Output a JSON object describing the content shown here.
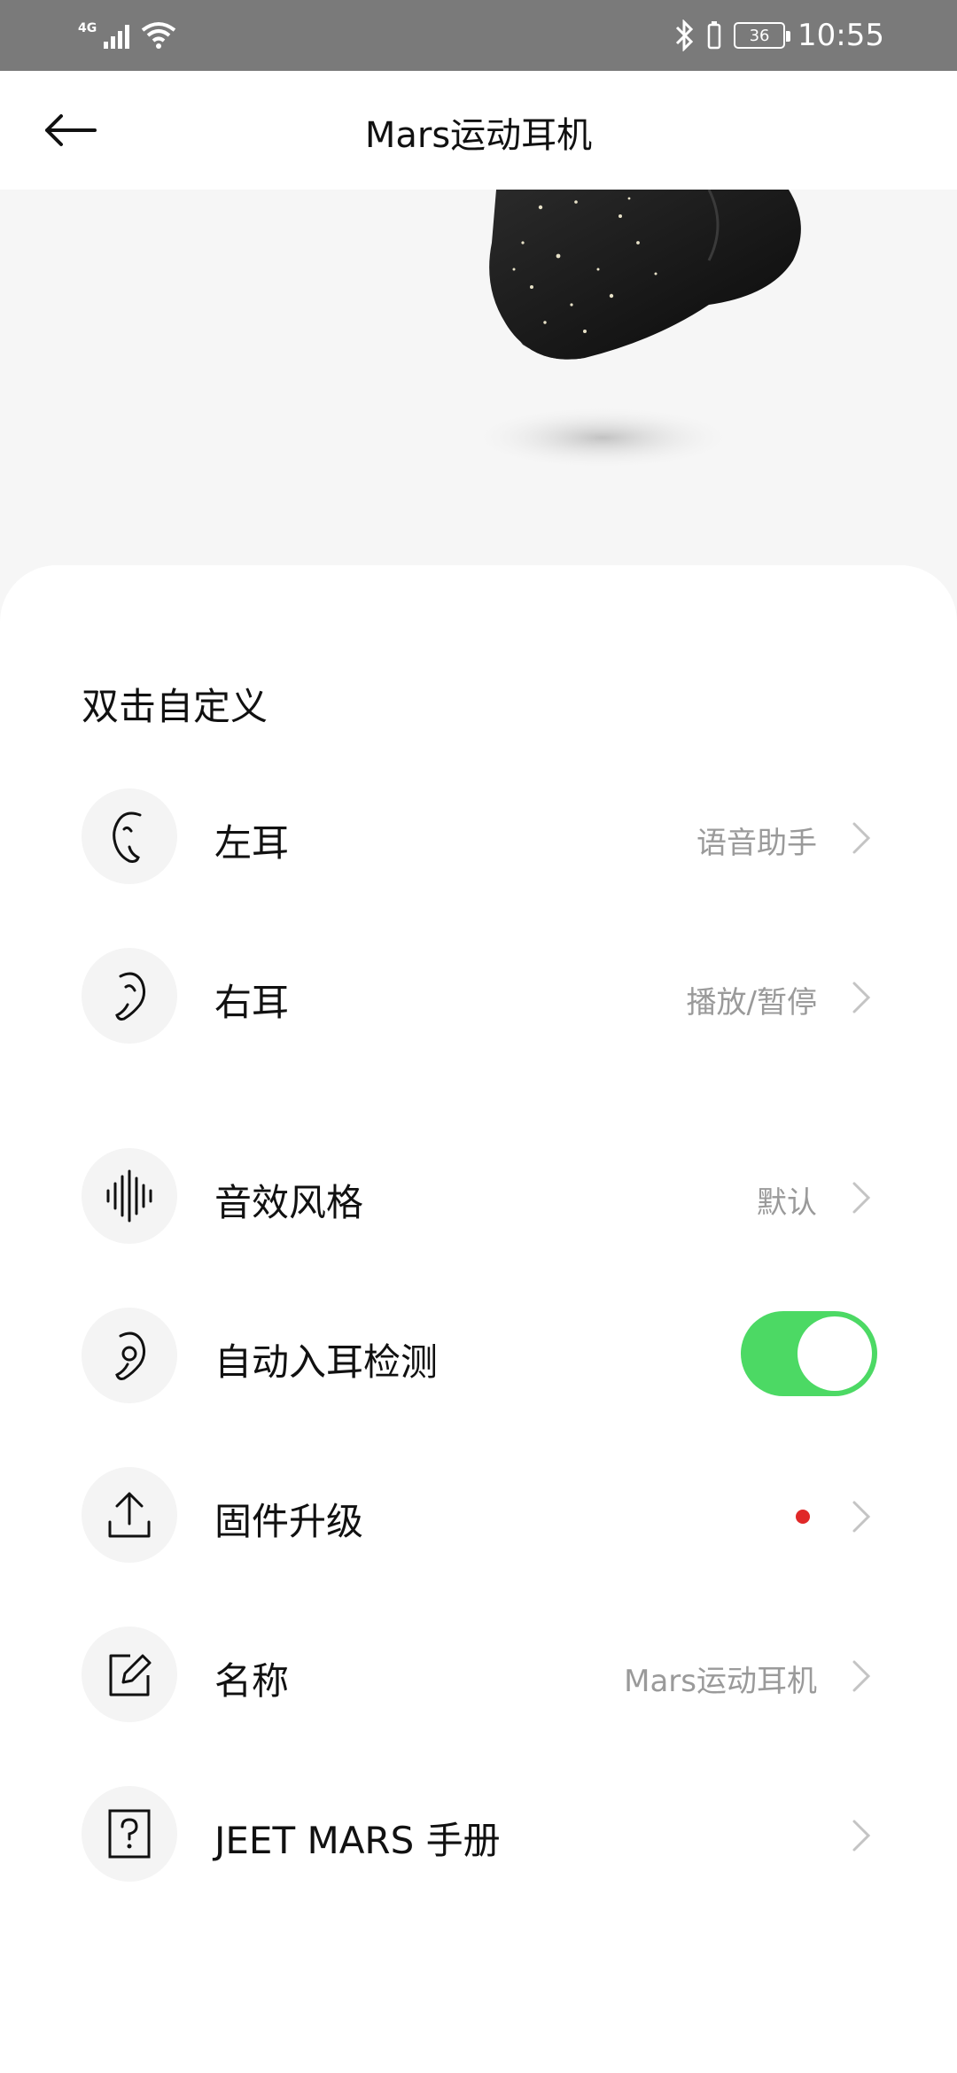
{
  "status_bar": {
    "network": "4G",
    "battery": "36",
    "time": "10:55"
  },
  "header": {
    "title": "Mars运动耳机"
  },
  "section": {
    "title": "双击自定义"
  },
  "rows": {
    "left_ear": {
      "label": "左耳",
      "value": "语音助手",
      "icon": "left-ear-icon"
    },
    "right_ear": {
      "label": "右耳",
      "value": "播放/暂停",
      "icon": "right-ear-icon"
    },
    "sound_style": {
      "label": "音效风格",
      "value": "默认",
      "icon": "soundwave-icon"
    },
    "auto_ear_detect": {
      "label": "自动入耳检测",
      "toggle_on": true,
      "icon": "ear-detect-icon"
    },
    "firmware": {
      "label": "固件升级",
      "has_update_dot": true,
      "icon": "upload-icon"
    },
    "name": {
      "label": "名称",
      "value": "Mars运动耳机",
      "icon": "edit-icon"
    },
    "manual": {
      "label": "JEET MARS 手册",
      "icon": "help-icon"
    }
  },
  "colors": {
    "status_bar_bg": "#7a7a7a",
    "toggle_on": "#4cd964",
    "update_dot": "#e02828",
    "value_text": "#9a9a9a"
  }
}
